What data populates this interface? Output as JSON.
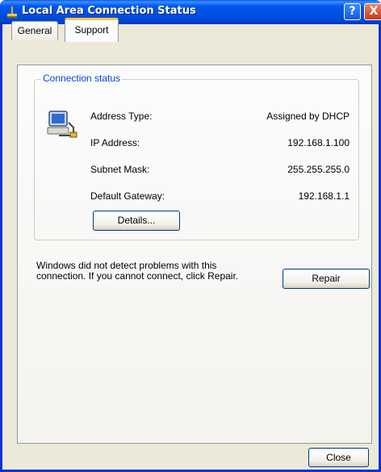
{
  "window": {
    "title": "Local Area Connection Status"
  },
  "titlebar": {
    "help_label": "?",
    "close_label": "X"
  },
  "tabs": [
    {
      "label": "General"
    },
    {
      "label": "Support"
    }
  ],
  "connection_status": {
    "group_label": "Connection status",
    "rows": [
      {
        "label": "Address Type:",
        "value": "Assigned by DHCP"
      },
      {
        "label": "IP Address:",
        "value": "192.168.1.100"
      },
      {
        "label": "Subnet Mask:",
        "value": "255.255.255.0"
      },
      {
        "label": "Default Gateway:",
        "value": "192.168.1.1"
      }
    ],
    "details_label": "Details..."
  },
  "message": "Windows did not detect problems with this connection. If you cannot connect, click Repair.",
  "repair_label": "Repair",
  "close_label": "Close",
  "colors": {
    "titlebar": "#0054E3",
    "window_bg": "#ECE9D8",
    "tab_accent": "#FFC83C",
    "group_label": "#0046D5"
  },
  "icons": {
    "title": "network-connection-icon",
    "status": "network-computer-icon"
  }
}
